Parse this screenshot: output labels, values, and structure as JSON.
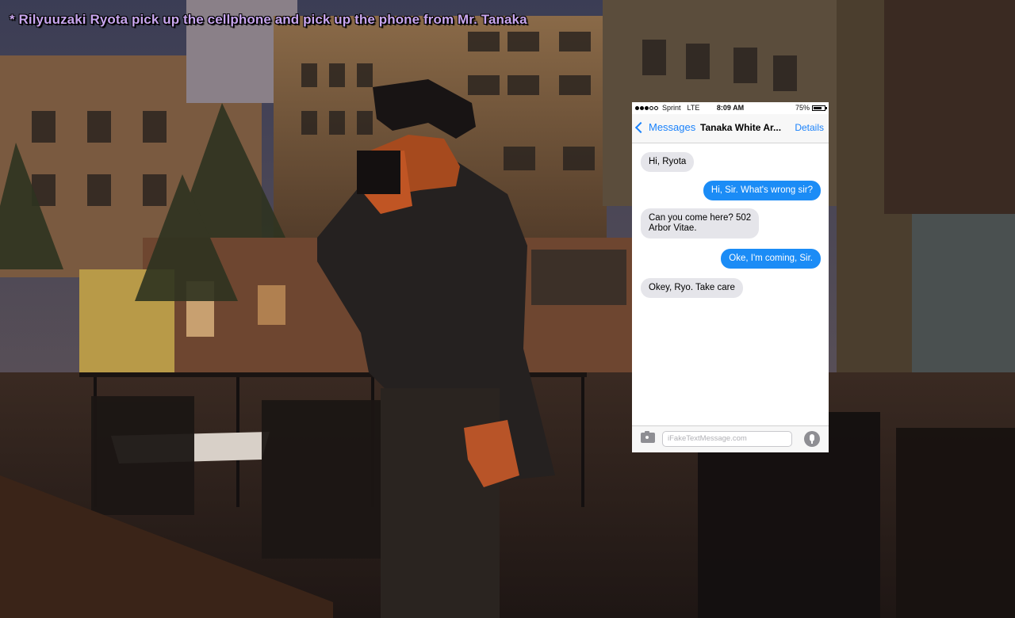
{
  "chat": {
    "line": "* Rilyuuzaki Ryota pick up the cellphone and pick up the phone from Mr. Tanaka",
    "color": "#c8a6ee"
  },
  "phone": {
    "status": {
      "carrier": "Sprint",
      "network": "LTE",
      "time": "8:09 AM",
      "battery": "75%",
      "battery_level": 0.75
    },
    "nav": {
      "back_label": "Messages",
      "title": "Tanaka White Ar...",
      "details_label": "Details"
    },
    "messages": [
      {
        "from": "them",
        "text": "Hi, Ryota"
      },
      {
        "from": "me",
        "text": "Hi, Sir. What's wrong sir?"
      },
      {
        "from": "them",
        "line1": "Can you come here? 502",
        "line2": "Arbor Vitae."
      },
      {
        "from": "me",
        "text": "Oke, I'm coming, Sir."
      },
      {
        "from": "them",
        "text": "Okey, Ryo. Take care"
      }
    ],
    "input": {
      "placeholder": "iFakeTextMessage.com"
    },
    "colors": {
      "accent": "#1a82fb",
      "bubble_out": "#1b8cf6",
      "bubble_in": "#e5e5ea"
    }
  }
}
